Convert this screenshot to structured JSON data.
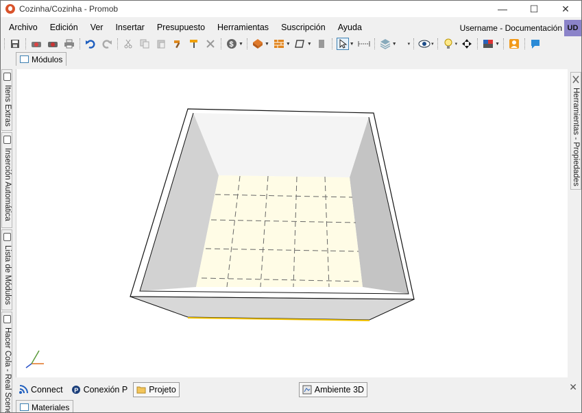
{
  "window": {
    "title": "Cozinha/Cozinha - Promob",
    "minimize": "—",
    "maximize": "☐",
    "close": "✕"
  },
  "menu": {
    "items": [
      "Archivo",
      "Edición",
      "Ver",
      "Insertar",
      "Presupuesto",
      "Herramientas",
      "Suscripción",
      "Ayuda"
    ],
    "user": "Username - Documentación",
    "user_initials": "UD"
  },
  "toolbar": {
    "icons": [
      "save-icon",
      "render-icon",
      "render2-icon",
      "print-icon",
      "undo-icon",
      "redo-icon",
      "cut-icon",
      "copy-icon",
      "paste-icon",
      "hammer-icon",
      "paintbrush-icon",
      "delete-icon",
      "budget-icon",
      "catalog-icon",
      "wall-icon",
      "shape-icon",
      "door-icon",
      "select-icon",
      "measure-icon",
      "layers-icon",
      "eye-icon",
      "light-icon",
      "move-icon",
      "palette-icon",
      "user-icon",
      "chat-icon"
    ]
  },
  "top_tab": {
    "label": "Módulos"
  },
  "left_tabs": [
    "Itens Extras",
    "Inserción Automática",
    "Lista de Módulos",
    "Hacer Cola - Real Scene"
  ],
  "right_tab": "Herramientas - Propiedades",
  "bottom_tabs": [
    {
      "label": "Connect",
      "icon": "connect-icon"
    },
    {
      "label": "Conexión P",
      "icon": "conexion-icon"
    },
    {
      "label": "Projeto",
      "icon": "folder-icon",
      "selected": true
    }
  ],
  "center_tab": {
    "label": "Ambiente 3D",
    "icon": "3d-view-icon"
  },
  "bottom_tab2": {
    "label": "Materiales"
  },
  "colors": {
    "floor": "#fffce6",
    "wall_left": "#d2d2d2",
    "wall_right": "#c4c4c4",
    "wall_back": "#f4f4f4",
    "accent": "#3c7fb1",
    "user_badge": "#8b83c9"
  }
}
